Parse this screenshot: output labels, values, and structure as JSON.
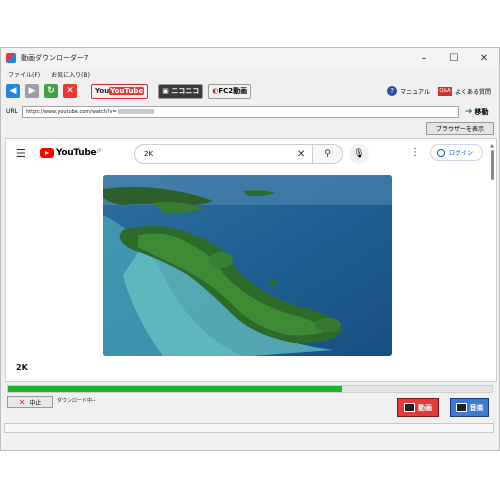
{
  "window": {
    "title": "動画ダウンローダー7"
  },
  "menu": [
    "ファイル(F)",
    "お気に入り(B)"
  ],
  "toolbar": {
    "youtube_label": "YouTube",
    "niconico_label": "ニコニコ",
    "fc2_label": "FC2動画",
    "manual_label": "マニュアル",
    "faq_label": "よくある質問",
    "faq_badge": "Q&A"
  },
  "url": {
    "label": "URL",
    "value": "https://www.youtube.com/watch?v=",
    "go_label": "移動"
  },
  "show_browser_label": "ブラウザーを表示",
  "youtube": {
    "logo_text": "YouTube",
    "logo_region": "JP",
    "search_value": "2K",
    "login_label": "ログイン",
    "video_title": "2K"
  },
  "download": {
    "progress": 0.69,
    "stop_label": "中止",
    "status_text": "ダウンロード中--",
    "video_label": "動画",
    "audio_label": "音楽"
  },
  "colors": {
    "progress": "#1db32e",
    "video_button": "#e33a3a",
    "audio_button": "#3e79d6",
    "youtube_red": "#ff0000"
  }
}
